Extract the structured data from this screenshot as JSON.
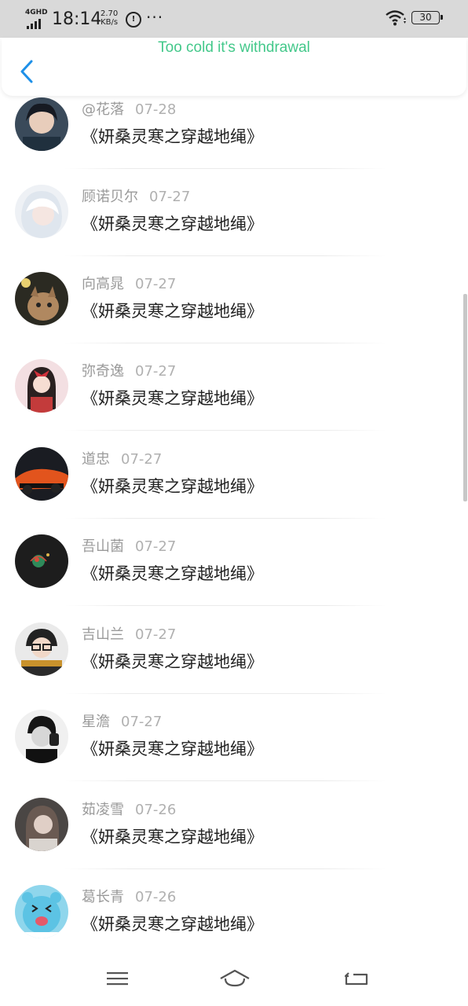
{
  "status_bar": {
    "network_type": "4GHD",
    "time": "18:14",
    "speed_value": "2.70",
    "speed_unit": "KB/s",
    "alert_glyph": "Ⓛ",
    "more": "···",
    "battery": "30"
  },
  "header": {
    "back_icon": "chevron-left-icon",
    "toast": "Too cold it's withdrawal"
  },
  "comments": [
    {
      "user": "@花落",
      "date": "07-28",
      "book": "《妍桑灵寒之穿越地绳》"
    },
    {
      "user": "顾诺贝尔",
      "date": "07-27",
      "book": "《妍桑灵寒之穿越地绳》"
    },
    {
      "user": "向高晁",
      "date": "07-27",
      "book": "《妍桑灵寒之穿越地绳》"
    },
    {
      "user": "弥奇逸",
      "date": "07-27",
      "book": "《妍桑灵寒之穿越地绳》"
    },
    {
      "user": "道忠",
      "date": "07-27",
      "book": "《妍桑灵寒之穿越地绳》"
    },
    {
      "user": "吾山菌",
      "date": "07-27",
      "book": "《妍桑灵寒之穿越地绳》"
    },
    {
      "user": "吉山兰",
      "date": "07-27",
      "book": "《妍桑灵寒之穿越地绳》"
    },
    {
      "user": "星澹",
      "date": "07-27",
      "book": "《妍桑灵寒之穿越地绳》"
    },
    {
      "user": "茹凌雪",
      "date": "07-26",
      "book": "《妍桑灵寒之穿越地绳》"
    },
    {
      "user": "葛长青",
      "date": "07-26",
      "book": "《妍桑灵寒之穿越地绳》"
    }
  ],
  "nav_bar": {
    "menu_icon": "menu-icon",
    "home_icon": "home-icon",
    "back_icon": "back-icon"
  },
  "colors": {
    "toast": "#43c88a",
    "accent": "#1e90e8",
    "status_bar_bg": "#d9d9d9"
  }
}
